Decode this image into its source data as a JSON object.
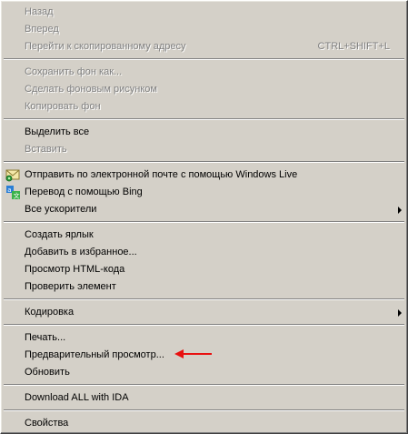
{
  "menu": {
    "groups": [
      [
        {
          "label": "Назад",
          "disabled": true
        },
        {
          "label": "Вперед",
          "disabled": true
        },
        {
          "label": "Перейти к скопированному адресу",
          "shortcut": "CTRL+SHIFT+L",
          "disabled": true
        }
      ],
      [
        {
          "label": "Сохранить фон как...",
          "disabled": true
        },
        {
          "label": "Сделать фоновым рисунком",
          "disabled": true
        },
        {
          "label": "Копировать фон",
          "disabled": true
        }
      ],
      [
        {
          "label": "Выделить все",
          "disabled": false
        },
        {
          "label": "Вставить",
          "disabled": true
        }
      ],
      [
        {
          "label": "Отправить по электронной почте с помощью Windows Live",
          "icon": "windows-live-mail-icon"
        },
        {
          "label": "Перевод с помощью Bing",
          "icon": "bing-translate-icon"
        },
        {
          "label": "Все ускорители",
          "submenu": true
        }
      ],
      [
        {
          "label": "Создать ярлык"
        },
        {
          "label": "Добавить в избранное..."
        },
        {
          "label": "Просмотр HTML-кода"
        },
        {
          "label": "Проверить элемент"
        }
      ],
      [
        {
          "label": "Кодировка",
          "submenu": true
        }
      ],
      [
        {
          "label": "Печать..."
        },
        {
          "label": "Предварительный просмотр..."
        },
        {
          "label": "Обновить"
        }
      ],
      [
        {
          "label": "Download ALL with IDA"
        }
      ],
      [
        {
          "label": "Свойства"
        }
      ]
    ]
  },
  "colors": {
    "menu_bg": "#d4d0c8",
    "disabled_text": "#808080",
    "annotation_arrow": "#e81010"
  },
  "annotation": {
    "type": "red-arrow-icon",
    "points_to": "Предварительный просмотр..."
  }
}
